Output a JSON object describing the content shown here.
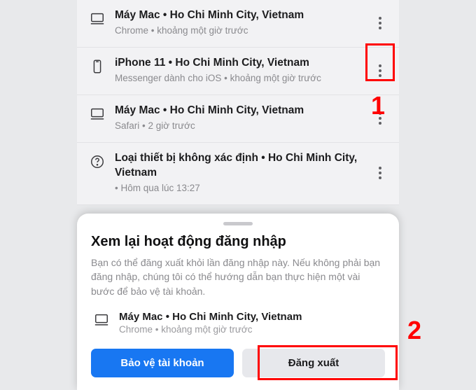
{
  "devices": [
    {
      "icon": "desktop",
      "title": "Máy Mac • Ho Chi Minh City, Vietnam",
      "sub": "Chrome • khoảng một giờ trước"
    },
    {
      "icon": "phone",
      "title": "iPhone 11 • Ho Chi Minh City, Vietnam",
      "sub": "Messenger dành cho iOS • khoảng một giờ trước"
    },
    {
      "icon": "desktop",
      "title": "Máy Mac • Ho Chi Minh City, Vietnam",
      "sub": "Safari • 2 giờ trước"
    },
    {
      "icon": "unknown",
      "title": "Loại thiết bị không xác định • Ho Chi Minh City, Vietnam",
      "sub": " • Hôm qua lúc 13:27"
    }
  ],
  "sheet": {
    "title": "Xem lại hoạt động đăng nhập",
    "desc": "Bạn có thể đăng xuất khỏi lần đăng nhập này. Nếu không phải bạn đăng nhập, chúng tôi có thể hướng dẫn bạn thực hiện một vài bước để bảo vệ tài khoản.",
    "device": {
      "title": "Máy Mac • Ho Chi Minh City, Vietnam",
      "sub": "Chrome • khoảng một giờ trước"
    },
    "protect_label": "Bảo vệ tài khoản",
    "logout_label": "Đăng xuất"
  },
  "annotations": {
    "n1": "1",
    "n2": "2"
  }
}
